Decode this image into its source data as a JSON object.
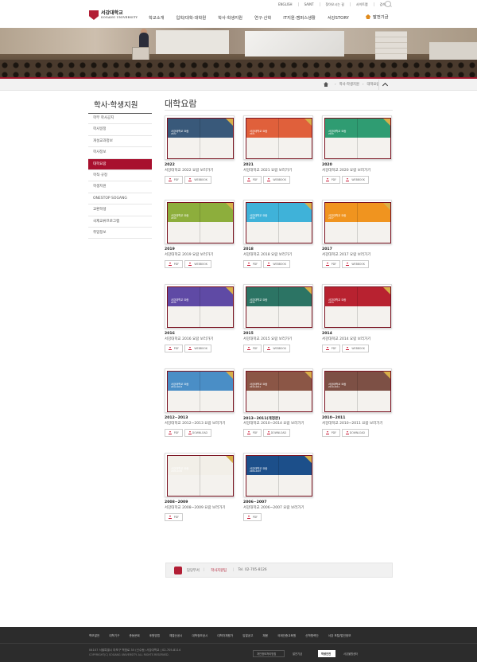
{
  "util_links": [
    "ENGLISH",
    "SAINT",
    "찾아오시는 길",
    "사이트맵",
    "검색"
  ],
  "logo": {
    "kr": "서강대학교",
    "en": "SOGANG UNIVERSITY"
  },
  "gnb": [
    "학교소개",
    "입학/대학·대학원",
    "학사·학생지원",
    "연구·산학",
    "IT지원·캠퍼스생활",
    "서강STORY"
  ],
  "fund_label": "발전기금",
  "breadcrumb": [
    "학사·학생지원",
    "대학요람"
  ],
  "sidebar": {
    "title": "학사·학생지원",
    "items": [
      "학부 학사공지",
      "학사일정",
      "개설교과정보",
      "학사정보",
      "대학요람",
      "학칙·규정",
      "학생지원",
      "ONESTOP SOGANG",
      "교환학생",
      "국제교류프로그램",
      "취업정보"
    ],
    "active_index": 4
  },
  "page_title": "대학요람",
  "cover_title": "서강대학교 요람",
  "cards": [
    {
      "year": "2022",
      "desc": "서강대학교 2022 요람 보러가기",
      "color": "#39597a",
      "cover_year": "2022",
      "buttons": [
        "PDF",
        "WEBBOOK"
      ]
    },
    {
      "year": "2021",
      "desc": "서강대학교 2021 요람 보러가기",
      "color": "#e0603b",
      "cover_year": "2021",
      "buttons": [
        "PDF",
        "WEBBOOK"
      ]
    },
    {
      "year": "2020",
      "desc": "서강대학교 2020 요람 보러가기",
      "color": "#2f9c72",
      "cover_year": "2020",
      "buttons": [
        "PDF",
        "WEBBOOK"
      ]
    },
    {
      "year": "2019",
      "desc": "서강대학교 2019 요람 보러가기",
      "color": "#8dae3c",
      "cover_year": "2019",
      "buttons": [
        "PDF",
        "WEBBOOK"
      ]
    },
    {
      "year": "2018",
      "desc": "서강대학교 2018 요람 보러가기",
      "color": "#3fb2d9",
      "cover_year": "2018",
      "buttons": [
        "PDF",
        "WEBBOOK"
      ]
    },
    {
      "year": "2017",
      "desc": "서강대학교 2017 요람 보러가기",
      "color": "#f0941f",
      "cover_year": "2017",
      "buttons": [
        "PDF",
        "WEBBOOK"
      ]
    },
    {
      "year": "2016",
      "desc": "서강대학교 2016 요람 보러가기",
      "color": "#5f4aa5",
      "cover_year": "2016",
      "buttons": [
        "PDF",
        "WEBBOOK"
      ]
    },
    {
      "year": "2015",
      "desc": "서강대학교 2015 요람 보러가기",
      "color": "#2c7464",
      "cover_year": "2015",
      "buttons": [
        "PDF",
        "WEBBOOK"
      ]
    },
    {
      "year": "2014",
      "desc": "서강대학교 2014 요람 보러가기",
      "color": "#b82230",
      "cover_year": "2014",
      "buttons": [
        "PDF",
        "WEBBOOK"
      ]
    },
    {
      "year": "2012~2013",
      "desc": "서강대학교 2012~2013 요람 보러가기",
      "color": "#4a8ec6",
      "cover_year": "2012-2013",
      "buttons": [
        "PDF",
        "DOWNLOAD"
      ]
    },
    {
      "year": "2013~2011(개정본)",
      "desc": "서강대학교 2010~2014 요람 보러가기",
      "color": "#8b5646",
      "cover_year": "2010-2011",
      "buttons": [
        "PDF",
        "DOWNLOAD"
      ]
    },
    {
      "year": "2010~2011",
      "desc": "서강대학교 2010~2011 요람 보러가기",
      "color": "#7d5045",
      "cover_year": "2010-2011",
      "buttons": [
        "PDF",
        "DOWNLOAD"
      ]
    },
    {
      "year": "2008~2009",
      "desc": "서강대학교 2008~2009 요람 보러가기",
      "color": "#f2efe8",
      "cover_year": "2008-2009",
      "buttons": [
        "PDF"
      ]
    },
    {
      "year": "2006~2007",
      "desc": "서강대학교 2006~2007 요람 보러가기",
      "color": "#1c4f8a",
      "cover_year": "2006-2007",
      "buttons": [
        "PDF"
      ]
    }
  ],
  "contact": {
    "label": "담당부서",
    "dept": "학사지원팀",
    "tel": "Tel. 02-705-8126"
  },
  "footer": {
    "links": [
      "학보발전",
      "대학기구",
      "총동문회",
      "후원방법",
      "예결산공시",
      "대학정보공시",
      "대학자체평가",
      "입찰공고",
      "채용",
      "국제인증교육원",
      "신학협력단",
      "서강 포탈/법인정보"
    ],
    "address": "04107 서울특별시 마포구 백범로 35 (신수동) 서강대학교 | 02-705-8114",
    "copyright": "COPYRIGHT(C) SOGANG UNIVERSITY. ALL RIGHTS RESERVED.",
    "badges": [
      "개인정보처리방침",
      "발전기금",
      "학생안전",
      "서강불원센터"
    ]
  }
}
